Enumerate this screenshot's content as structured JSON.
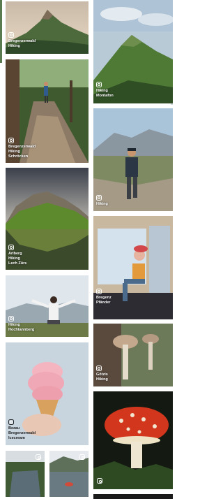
{
  "feed": {
    "left_column": [
      {
        "id": "l1",
        "caption": [
          "Bregenzerwald",
          "Hiking"
        ],
        "icon": "instagram-icon"
      },
      {
        "id": "l2",
        "caption": [
          "Bregenzerwald",
          "Hiking",
          "Schröcken"
        ],
        "icon": "instagram-icon"
      },
      {
        "id": "l3",
        "caption": [
          "Arlberg",
          "Hiking",
          "Lech Zürs"
        ],
        "icon": "instagram-icon"
      },
      {
        "id": "l4",
        "caption": [
          "Hiking",
          "Hochtannberg"
        ],
        "icon": "instagram-icon"
      },
      {
        "id": "l5",
        "caption": [
          "Bezau",
          "Bregenzerwald",
          "Icecream"
        ],
        "icon": "instagram-icon"
      },
      {
        "id": "l6",
        "caption": [],
        "icon": "instagram-icon"
      },
      {
        "id": "l7",
        "caption": [],
        "icon": "instagram-icon"
      }
    ],
    "right_column": [
      {
        "id": "r1",
        "caption": [],
        "icon": "instagram-icon"
      },
      {
        "id": "r2",
        "caption": [
          "Hiking",
          "Montafon"
        ],
        "icon": "instagram-icon"
      },
      {
        "id": "r3",
        "caption": [
          "Hiking"
        ],
        "icon": "instagram-icon"
      },
      {
        "id": "r4",
        "caption": [
          "Bregenz",
          "Pfänder"
        ],
        "icon": "instagram-icon"
      },
      {
        "id": "r5",
        "caption": [
          "Götzis",
          "Hiking"
        ],
        "icon": "instagram-icon"
      },
      {
        "id": "r6",
        "caption": [],
        "icon": "instagram-icon"
      }
    ]
  }
}
